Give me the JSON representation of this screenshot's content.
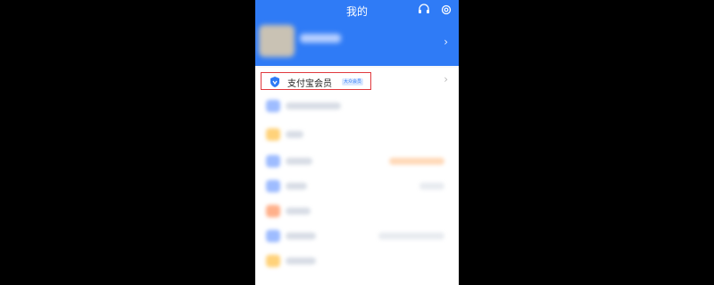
{
  "header": {
    "title": "我的",
    "icons": [
      "headset-icon",
      "gear-icon"
    ],
    "color": "#2f7bf6"
  },
  "member": {
    "label": "支付宝会员",
    "badge": "大众会员",
    "highlight_color": "#e0393e"
  },
  "list_rows": [
    {
      "icon_color": "#9ebcff"
    },
    {
      "icon_color": "#ffd27a"
    },
    {
      "icon_color": "#9ebcff"
    },
    {
      "icon_color": "#9ebcff"
    },
    {
      "icon_color": "#ffb08a"
    },
    {
      "icon_color": "#9ebcff"
    },
    {
      "icon_color": "#ffd27a"
    }
  ]
}
